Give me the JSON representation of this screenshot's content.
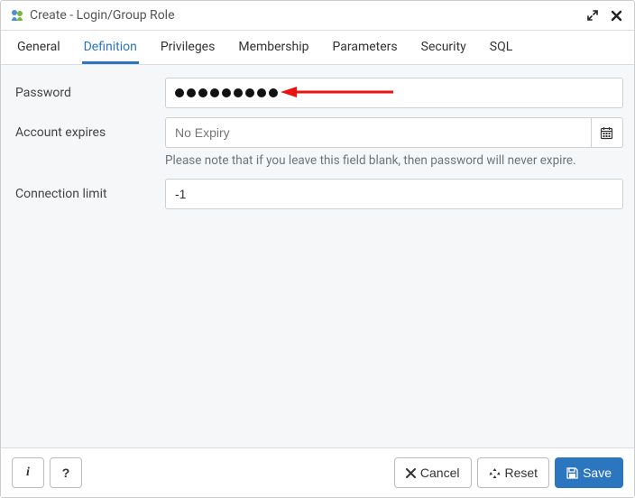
{
  "titlebar": {
    "title": "Create - Login/Group Role"
  },
  "tabs": {
    "general": "General",
    "definition": "Definition",
    "privileges": "Privileges",
    "membership": "Membership",
    "parameters": "Parameters",
    "security": "Security",
    "sql": "SQL",
    "active": "definition"
  },
  "form": {
    "password_label": "Password",
    "password_dot_count": 9,
    "account_expires_label": "Account expires",
    "account_expires_placeholder": "No Expiry",
    "account_expires_help": "Please note that if you leave this field blank, then password will never expire.",
    "connection_limit_label": "Connection limit",
    "connection_limit_value": "-1"
  },
  "footer": {
    "info": "i",
    "help": "?",
    "cancel": "Cancel",
    "reset": "Reset",
    "save": "Save"
  }
}
